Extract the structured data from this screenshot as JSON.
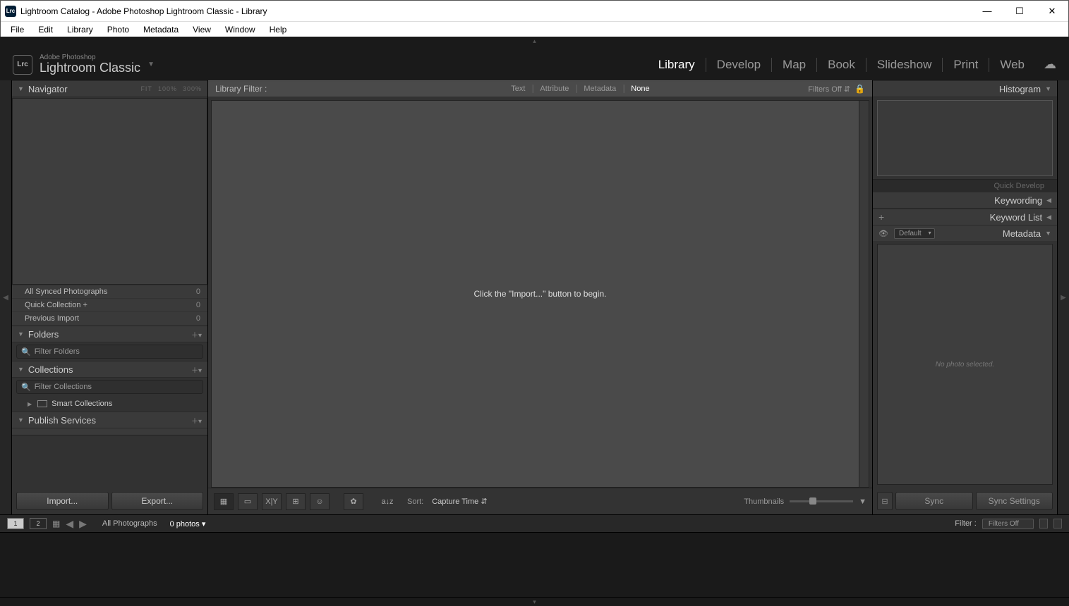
{
  "window": {
    "title": "Lightroom Catalog - Adobe Photoshop Lightroom Classic - Library",
    "logo_text": "Lrc"
  },
  "menu": [
    "File",
    "Edit",
    "Library",
    "Photo",
    "Metadata",
    "View",
    "Window",
    "Help"
  ],
  "brand": {
    "sup": "Adobe Photoshop",
    "main": "Lightroom Classic"
  },
  "modules": [
    "Library",
    "Develop",
    "Map",
    "Book",
    "Slideshow",
    "Print",
    "Web"
  ],
  "active_module": "Library",
  "left": {
    "navigator": {
      "title": "Navigator",
      "zoom": [
        "FIT",
        "100%",
        "300%"
      ]
    },
    "catalog_rows": [
      {
        "label": "All Synced Photographs",
        "count": "0"
      },
      {
        "label": "Quick Collection  +",
        "count": "0"
      },
      {
        "label": "Previous Import",
        "count": "0"
      }
    ],
    "folders": {
      "title": "Folders",
      "filter_placeholder": "Filter Folders"
    },
    "collections": {
      "title": "Collections",
      "filter_placeholder": "Filter Collections",
      "smart": "Smart Collections"
    },
    "publish": {
      "title": "Publish Services"
    },
    "buttons": {
      "import": "Import...",
      "export": "Export..."
    }
  },
  "center": {
    "filter_label": "Library Filter :",
    "tabs": [
      "Text",
      "Attribute",
      "Metadata",
      "None"
    ],
    "active_tab": "None",
    "filters_off": "Filters Off",
    "empty_msg": "Click the \"Import...\" button to begin.",
    "toolbar": {
      "sort_label": "Sort:",
      "sort_value": "Capture Time",
      "thumb_label": "Thumbnails"
    }
  },
  "right": {
    "histogram": "Histogram",
    "quick_develop": "Quick Develop",
    "keywording": "Keywording",
    "keyword_list": "Keyword List",
    "metadata": "Metadata",
    "metadata_preset": "Default",
    "no_photo": "No photo selected.",
    "buttons": {
      "sync": "Sync",
      "sync_settings": "Sync Settings"
    }
  },
  "filmstrip": {
    "source": "All Photographs",
    "count": "0 photos",
    "filter_label": "Filter :",
    "filter_value": "Filters Off"
  }
}
